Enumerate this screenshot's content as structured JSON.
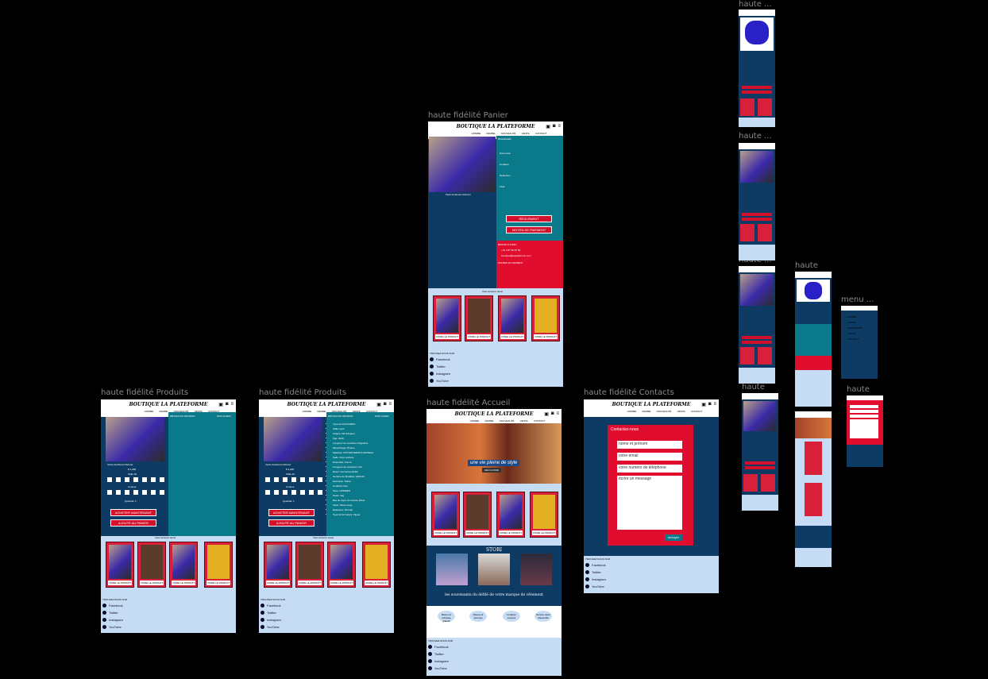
{
  "frames": {
    "produits1": "haute fidélité Produits",
    "produits2": "haute fidélité Produits",
    "panier": "haute fidélité Panier",
    "accueil": "haute fidélité Accueil",
    "contacts": "haute fidélité Contacts",
    "mini1": "haute ...",
    "mini2": "haute ...",
    "mini3": "haute ...",
    "mini4": "haute",
    "mini5": "haute",
    "mini6": "haute",
    "menu": "menu ..."
  },
  "brand": "BOUTIQUE LA PLATEFORME",
  "nav": [
    "HOMME",
    "FEMME",
    "NOUVEAUTÉ",
    "VENTE",
    "CONTACT"
  ],
  "product": {
    "tab_details": "DÉTAILS DU PRODUIT",
    "tab_reviews": "AVIS CLIENT",
    "name": "Veste doudoune Reterer",
    "price": "€ 2,208",
    "size_label": "Taille 40",
    "color_label": "Couleur",
    "qty_label": "Quantité: 1",
    "buy_now": "ACHETER MAINTENANT",
    "add_to_cart": "AJOUTÉ AU PANIER",
    "also_like": "Vous aimerez aussi",
    "details_list": [
      "Type de PUCCARDA",
      "Taille: Qu'il",
      "Origine: FR (Origine)",
      "Âge: 2019",
      "Longueur de manches: Réguliers",
      "Morphologie: Photos",
      "Matériau: POLYESTER/NYLON/PEAU",
      "Taille: Avec ceinture",
      "Ensemble: Fermé",
      "Longueur de manches: Non",
      "Décor: Fermeture Éclair",
      "Nombre de Modèles: QR0143",
      "Extension: Sobre",
      "Certificat: Non",
      "Sexe: HOMMES",
      "Poids: 1kg",
      "Bas de Jupe: Fermeture Éclair",
      "Taper: fibres longs",
      "Épaisseur: Normal",
      "Type de fermeture: Zipper"
    ]
  },
  "card_label": "VOIRE LE PRODUIT",
  "socials_title": "TROUVEZ NOUS SUR",
  "socials": [
    "Facebook",
    "Twitter",
    "Instagram",
    "YouTube"
  ],
  "accueil": {
    "hero_caption": "une vie pleine de style",
    "hero_button": "DÉCOUVRIR",
    "stories_title": "STORI",
    "stories_caption": "les souvenants du défilé de votre marque de vêtement",
    "features": [
      "Retour et échange gratuits",
      "Paiement sécurisé",
      "Livraison express",
      "Service client disponible"
    ]
  },
  "panier": {
    "product_name": "Pack doudoune Reterer",
    "cart_heading": "Récapitulatif",
    "rows": [
      "Sous-total",
      "Livraison",
      "Réduction",
      "Total"
    ],
    "payment": "RÈGLEMENT",
    "payment_mode": "MOYEN DE PAIEMENT",
    "help_title": "BESOIN D'AIDE?",
    "phone": "+33 4 87 56 87 54",
    "email": "boutique@laplateforme.com",
    "offers_title": "OFFRES DU MOMENT",
    "also_like": "Vous aimerez aussi"
  },
  "contacts": {
    "title": "Contactez-nous",
    "name_placeholder": "nome et prénom",
    "email_placeholder": "votre email",
    "phone_placeholder": "votre numéro de téléphone",
    "message_placeholder": "écrire un message",
    "send": "envoyer"
  },
  "menu": {
    "items": [
      "HOMME",
      "FEMME",
      "NOUVEAUTÉ",
      "VENTE",
      "CONTACT"
    ]
  },
  "colors": {
    "navy": "#0e3b64",
    "teal": "#0a7a8a",
    "red": "#e10d2e",
    "pale_blue": "#c6dcf5",
    "canvas": "#000000"
  }
}
